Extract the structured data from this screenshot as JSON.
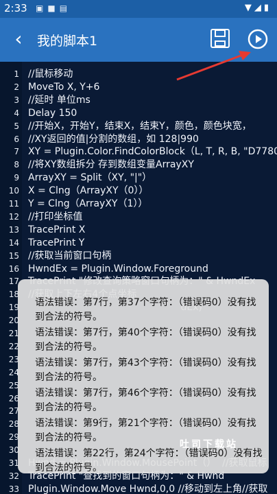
{
  "status_bar": {
    "time": "2:33",
    "left_icons": [
      "image-icon",
      "square-icon",
      "sim-icon"
    ],
    "right_icons": [
      "wifi-icon",
      "signal-icon",
      "battery-icon"
    ]
  },
  "app_bar": {
    "title": "我的脚本1",
    "back_icon": "back-chevron-icon",
    "save_icon": "save-icon",
    "run_icon": "play-icon",
    "color": "#2a72bf"
  },
  "editor": {
    "lines": [
      {
        "n": "1",
        "t": "//鼠标移动"
      },
      {
        "n": "2",
        "t": "MoveTo X, Y+6"
      },
      {
        "n": "3",
        "t": "//延时 单位ms"
      },
      {
        "n": "4",
        "t": "Delay 150"
      },
      {
        "n": "5",
        "t": "//开始X，开始Y，结束X，结束Y，颜色，颜色块宽，"
      },
      {
        "n": "6",
        "t": "//XY返回的值|分割的数组，如 128|990"
      },
      {
        "n": "7",
        "t": "XY = Plugin.Color.FindColorBlock（L, T, R, B, \"D7780"
      },
      {
        "n": "8",
        "t": "//将XY数组拆分 存到数组变量ArrayXY"
      },
      {
        "n": "9",
        "t": "ArrayXY = Split（XY, \"|\"）"
      },
      {
        "n": "10",
        "t": "X = Clng（ArrayXY（0））"
      },
      {
        "n": "11",
        "t": "Y = Clng（ArrayXY（1））"
      },
      {
        "n": "12",
        "t": "//打印坐标值"
      },
      {
        "n": "13",
        "t": "TracePrint X"
      },
      {
        "n": "14",
        "t": "TracePrint Y"
      },
      {
        "n": "15",
        "t": "//获取当前窗口句柄"
      },
      {
        "n": "16",
        "t": "HwndEx = Plugin.Window.Foreground"
      },
      {
        "n": "17",
        "t": "TracePrint \"修改查询策略窗口句柄为：\" & HwndEx"
      },
      {
        "n": "18",
        "t": "//获取上下左右4个点坐标"
      },
      {
        "n": "19",
        "t": "                                                  dEx)"
      },
      {
        "n": "20",
        "t": ""
      },
      {
        "n": "21",
        "t": ""
      },
      {
        "n": "22",
        "t": ""
      },
      {
        "n": "23",
        "t": ""
      },
      {
        "n": "24",
        "t": ""
      },
      {
        "n": "25",
        "t": ""
      },
      {
        "n": "26",
        "t": ""
      },
      {
        "n": "27",
        "t": ""
      },
      {
        "n": "28",
        "t": ""
      },
      {
        "n": "29",
        "t": ""
      },
      {
        "n": "30",
        "t": ""
      },
      {
        "n": "31",
        "t": "Hwnd = Plugin.Window.MousePoint（）  //获取鼠标"
      },
      {
        "n": "32",
        "t": "TracePrint \"查找到的窗口句柄为：\" & Hwnd"
      },
      {
        "n": "33",
        "t": "Plugin.Window.Move Hwnd,0,0 //移动到左上角//获取"
      }
    ]
  },
  "error_dialog": {
    "errors": [
      "语法错误：第7行，第37个字符：（错误码0）没有找到合法的符号。",
      "语法错误：第7行，第40个字符：（错误码0）没有找到合法的符号。",
      "语法错误：第7行，第43个字符：（错误码0）没有找到合法的符号。",
      "语法错误：第7行，第46个字符：（错误码0）没有找到合法的符号。",
      "语法错误：第9行，第21个字符：（错误码0）没有找到合法的符号。",
      "语法错误：第22行，第24个字符：（错误码0）没有找到合法的符号。"
    ]
  },
  "watermark": "吐司下载站"
}
